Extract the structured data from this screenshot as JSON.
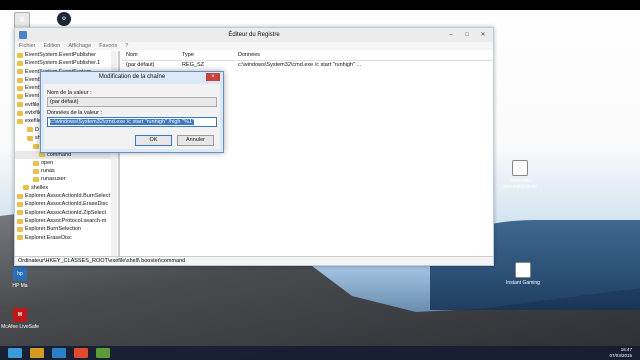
{
  "window": {
    "title": "Éditeur du Registre",
    "menu": [
      "Fichier",
      "Edition",
      "Affichage",
      "Favoris",
      "?"
    ],
    "tree_items": [
      {
        "label": "EventSystem.EventPublisher"
      },
      {
        "label": "EventSystem.EventPublisher.1"
      },
      {
        "label": "EventSystem.EventSystem"
      },
      {
        "label": "EventSystem.EventSystem.1"
      },
      {
        "label": "EventS"
      },
      {
        "label": "Event"
      },
      {
        "label": "evtfile"
      },
      {
        "label": "evtxfile"
      },
      {
        "label": "exefile"
      },
      {
        "label": "D"
      },
      {
        "label": "sh"
      },
      {
        "label": ""
      },
      {
        "label": "command"
      },
      {
        "label": "open"
      },
      {
        "label": "runas"
      },
      {
        "label": "runasuser"
      },
      {
        "label": "shellex"
      },
      {
        "label": "Explorer.AssocActionId.BurnSelect"
      },
      {
        "label": "Explorer.AssocActionId.EraseDisc"
      },
      {
        "label": "Explorer.AssocActionId.ZipSelect"
      },
      {
        "label": "Explorer.AssocProtocol.search-m"
      },
      {
        "label": "Explorer.BurnSelection"
      },
      {
        "label": "Explorer.EraseDisc"
      }
    ],
    "list_headers": [
      "Nom",
      "Type",
      "Données"
    ],
    "list_rows": [
      {
        "name": "(par défaut)",
        "type": "REG_SZ",
        "data": "c:\\windows\\System32\\cmd.exe /c start \"runhigh\" ..."
      }
    ],
    "status_path": "Ordinateur\\HKEY_CLASSES_ROOT\\exefile\\shell\\ booster\\command"
  },
  "dialog": {
    "title": "Modification de la chaîne",
    "close_glyph": "×",
    "name_label": "Nom de la valeur :",
    "name_value": "(par défaut)",
    "data_label": "Données de la valeur :",
    "data_value": "c:\\windows\\System32\\cmd.exe /c start \"runhigh\" /high \"%1\"",
    "ok_label": "OK",
    "cancel_label": "Annuler"
  },
  "desktop": {
    "new_doc_label": "Nouveau document texte",
    "instant_gaming_label": "Instant Gaming",
    "mcafee_label": "McAfee LiveSafe",
    "hp_label": "HP Ma"
  },
  "taskbar": {
    "time": "16:47",
    "date": "07/03/2015"
  },
  "colors": {
    "accent": "#3b78c4",
    "dialog_bg": "#dbe8f7",
    "close_red": "#c7423a"
  }
}
